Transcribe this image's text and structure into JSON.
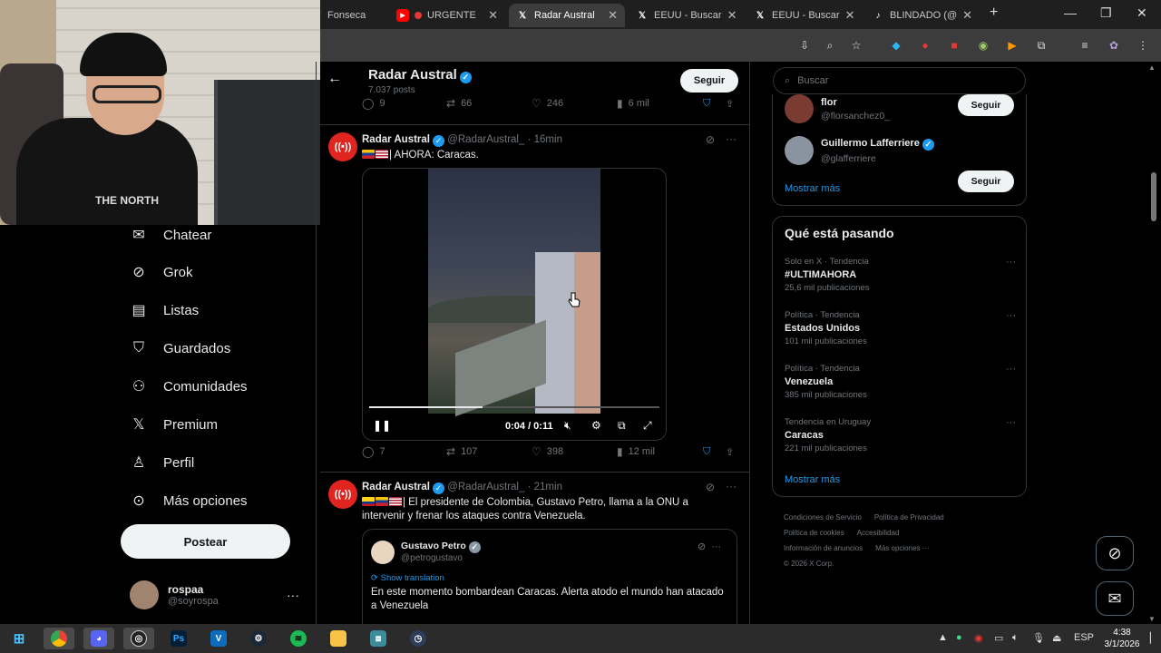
{
  "browser": {
    "tabs": [
      {
        "label": "Fonseca",
        "icon": "none",
        "active": false
      },
      {
        "label": "URGENTE",
        "icon": "youtube-icon",
        "active": false
      },
      {
        "label": "Radar Austral",
        "icon": "x-logo-icon",
        "active": true
      },
      {
        "label": "EEUU - Buscar",
        "icon": "x-logo-icon",
        "active": false
      },
      {
        "label": "EEUU - Buscar",
        "icon": "x-logo-icon",
        "active": false
      },
      {
        "label": "BLINDADO (@",
        "icon": "tiktok-icon",
        "active": false
      }
    ],
    "new_tab": "+"
  },
  "webcam": {
    "shirt_text": "THE NORTH"
  },
  "nav": {
    "items": [
      {
        "label": "Chatear",
        "icon": "mail-icon"
      },
      {
        "label": "Grok",
        "icon": "grok-icon"
      },
      {
        "label": "Listas",
        "icon": "list-icon"
      },
      {
        "label": "Guardados",
        "icon": "bookmark-icon"
      },
      {
        "label": "Comunidades",
        "icon": "communities-icon"
      },
      {
        "label": "Premium",
        "icon": "x-logo-icon"
      },
      {
        "label": "Perfil",
        "icon": "profile-icon"
      },
      {
        "label": "Más opciones",
        "icon": "more-circle-icon"
      }
    ],
    "post_button": "Postear",
    "account": {
      "name": "rospaa",
      "handle": "@soyrospa"
    }
  },
  "header": {
    "title": "Radar Austral",
    "subtitle": "7.037 posts",
    "follow": "Seguir"
  },
  "prev_actions": {
    "replies": "9",
    "reposts": "66",
    "likes": "246",
    "views": "6 mil"
  },
  "tweets": [
    {
      "name": "Radar Austral",
      "handle": "@RadarAustral_",
      "time": "16min",
      "text": "| AHORA: Caracas.",
      "video": {
        "time": "0:04 / 0:11",
        "progress": 0.39
      },
      "actions": {
        "replies": "7",
        "reposts": "107",
        "likes": "398",
        "views": "12 mil"
      }
    },
    {
      "name": "Radar Austral",
      "handle": "@RadarAustral_",
      "time": "21min",
      "text_line1": "| El presidente de Colombia, Gustavo Petro, llama a la ONU a",
      "text_line2": "intervenir y frenar los ataques contra Venezuela.",
      "quote": {
        "name": "Gustavo Petro",
        "handle": "@petrogustavo",
        "translate": "Show translation",
        "text": "En este momento bombardean Caracas. Alerta atodo el mundo han atacado a Venezuela"
      }
    }
  ],
  "right": {
    "search_placeholder": "Buscar",
    "who_to_follow": [
      {
        "name": "flor",
        "handle": "@florsanchez0_",
        "button": "Seguir"
      },
      {
        "name": "Guillermo Lafferriere",
        "handle": "@glafferriere",
        "button": "Seguir"
      }
    ],
    "show_more": "Mostrar más",
    "trending_title": "Qué está pasando",
    "trends": [
      {
        "context": "Solo en X · Tendencia",
        "name": "#ULTIMAHORA",
        "count": "25,6 mil publicaciones"
      },
      {
        "context": "Política · Tendencia",
        "name": "Estados Unidos",
        "count": "101 mil publicaciones"
      },
      {
        "context": "Política · Tendencia",
        "name": "Venezuela",
        "count": "385 mil publicaciones"
      },
      {
        "context": "Tendencia en Uruguay",
        "name": "Caracas",
        "count": "221 mil publicaciones"
      }
    ],
    "trend_show_more": "Mostrar más",
    "footer": {
      "terms": "Condiciones de Servicio",
      "privacy": "Política de Privacidad",
      "cookies": "Política de cookies",
      "accessibility": "Accesibilidad",
      "ads": "Información de anuncios",
      "more": "Más opciones ···",
      "copyright": "© 2026 X Corp."
    }
  },
  "taskbar": {
    "language": "ESP",
    "time": "4:38",
    "date": "3/1/2026"
  },
  "colors": {
    "accent": "#1d9bf0",
    "background": "#000000",
    "border": "#2f3336",
    "muted": "#71767b"
  }
}
